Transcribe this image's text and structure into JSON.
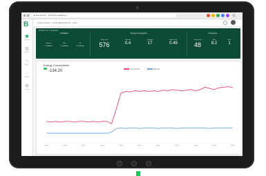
{
  "browser": {
    "url": "▲ Not Secure · https://app.loading.io"
  },
  "app": {
    "logo_text": "B",
    "sidebar_items": [
      {
        "icon": "home-icon",
        "label": "Overview"
      },
      {
        "icon": "chart-icon",
        "label": "Analytics"
      },
      {
        "icon": "alert-icon",
        "label": "Alerts"
      },
      {
        "icon": "grid-icon",
        "label": "Assets"
      },
      {
        "icon": "gear-icon",
        "label": "Settings"
      }
    ],
    "breadcrumb": "Lobby Cluster  >  Lobby Block 28-174  ·  Floor",
    "accent_color": "#0e4a38"
  },
  "panel": {
    "title": "TODAY AT A GLANCE",
    "groups": [
      {
        "title": "Ventilation",
        "cells": [
          {
            "label": "Setpoint",
            "value": "T. Ventilation"
          },
          {
            "label": "Zone",
            "value": "T. Ventilation"
          },
          {
            "label": "Air",
            "value": "T. Ventilation"
          }
        ]
      },
      {
        "title": "Energy Consumption",
        "cells": [
          {
            "label": "Today so far",
            "value": "576"
          },
          {
            "label": "Last hour",
            "value": "0.4"
          },
          {
            "label": "Yesterday",
            "value": "17"
          },
          {
            "label": "Avg last 24h",
            "value": "0.49"
          }
        ]
      },
      {
        "title": "Occupancy",
        "cells": [
          {
            "label": "Today so far",
            "value": "48"
          },
          {
            "label": "Now",
            "value": "8.2"
          },
          {
            "label": "Peak",
            "value": "1"
          }
        ]
      }
    ]
  },
  "chart_card": {
    "title": "Energy Consumption",
    "value": "-134.20",
    "legend": [
      {
        "name": "Consumption",
        "color": "#e5486a"
      },
      {
        "name": "Baseline",
        "color": "#6ea6e8"
      }
    ]
  },
  "chart_data": {
    "type": "line",
    "x": [
      0,
      1,
      2,
      3,
      4,
      5,
      6,
      7,
      8,
      9,
      10,
      11,
      12,
      13,
      14,
      15,
      16,
      17,
      18,
      19,
      20,
      21,
      22,
      23,
      24,
      25,
      26,
      27,
      28,
      29,
      30,
      31,
      32,
      33,
      34,
      35,
      36,
      37,
      38,
      39,
      40
    ],
    "series": [
      {
        "name": "Consumption",
        "values": [
          34,
          33,
          34,
          33,
          34,
          34,
          33,
          34,
          34,
          33,
          34,
          33,
          34,
          34,
          30,
          55,
          82,
          85,
          84,
          86,
          85,
          86,
          85,
          86,
          85,
          87,
          86,
          88,
          87,
          86,
          87,
          88,
          86,
          88,
          92,
          90,
          88,
          91,
          92,
          93,
          91
        ]
      },
      {
        "name": "Baseline",
        "values": [
          14,
          14,
          14,
          14,
          14,
          14,
          14,
          14,
          14,
          14,
          14,
          14,
          14,
          14,
          16,
          22,
          23,
          22,
          23,
          23,
          22,
          23,
          23,
          23,
          22,
          23,
          23,
          23,
          22,
          23,
          23,
          23,
          23,
          23,
          23,
          22,
          23,
          23,
          23,
          23,
          23
        ]
      }
    ],
    "ylim": [
      0,
      110
    ],
    "grid": false,
    "legend_position": "top-center"
  }
}
